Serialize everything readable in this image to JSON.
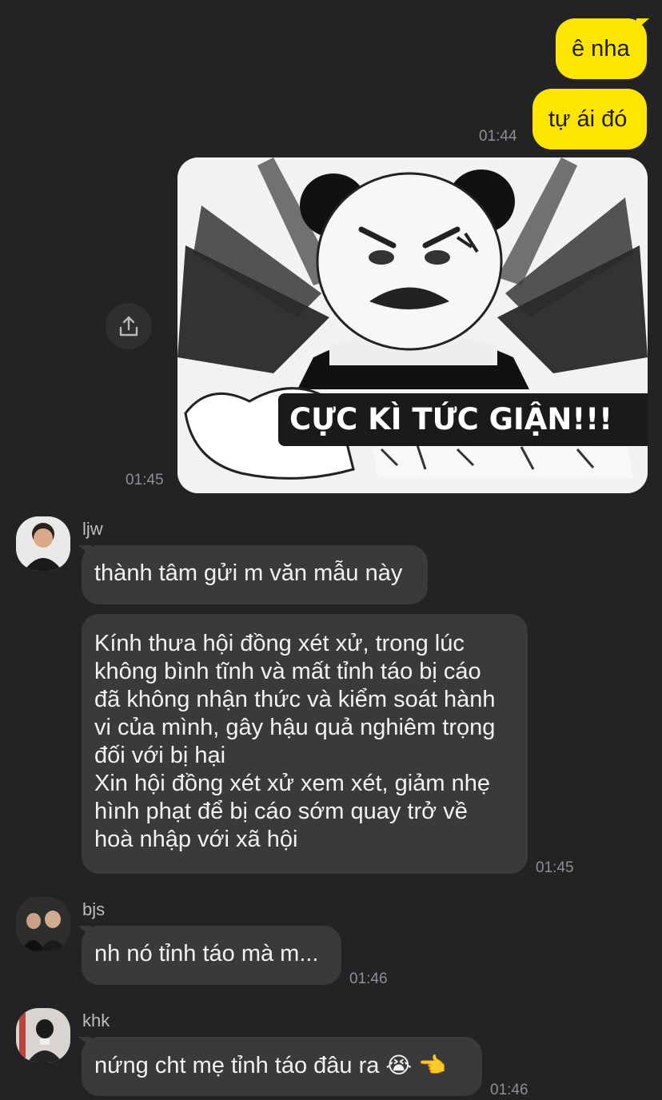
{
  "messages_out": [
    {
      "text": "ê nha"
    },
    {
      "text": "tự ái đó",
      "time": "01:44"
    }
  ],
  "sticker": {
    "caption": "CỰC KÌ TỨC GIẬN!!!",
    "time": "01:45"
  },
  "ljw": {
    "name": "ljw",
    "msg1": "thành tâm gửi m văn mẫu này",
    "msg2_lines": [
      "Kính thưa hội đồng xét xử, trong lúc",
      "không bình tĩnh và mất tỉnh táo bị cáo",
      "đã không nhận thức và kiểm soát hành",
      "vi của mình, gây hậu quả nghiêm trọng",
      "đối với bị hại",
      "Xin hội đồng xét xử xem xét, giảm nhẹ",
      "hình phạt để bị cáo sớm quay trở về",
      "hoà nhập với xã hội"
    ],
    "time": "01:45"
  },
  "bjs": {
    "name": "bjs",
    "msg": "nh nó tỉnh táo mà m...",
    "time": "01:46"
  },
  "khk": {
    "name": "khk",
    "msg": "nứng cht mẹ tỉnh táo đâu ra",
    "emoji": [
      "😭",
      "👈"
    ],
    "time": "01:46"
  },
  "icons": {
    "share": "share-icon"
  },
  "colors": {
    "background": "#232325",
    "outgoing_bubble": "#fee500",
    "incoming_bubble": "#3a3a3c"
  }
}
